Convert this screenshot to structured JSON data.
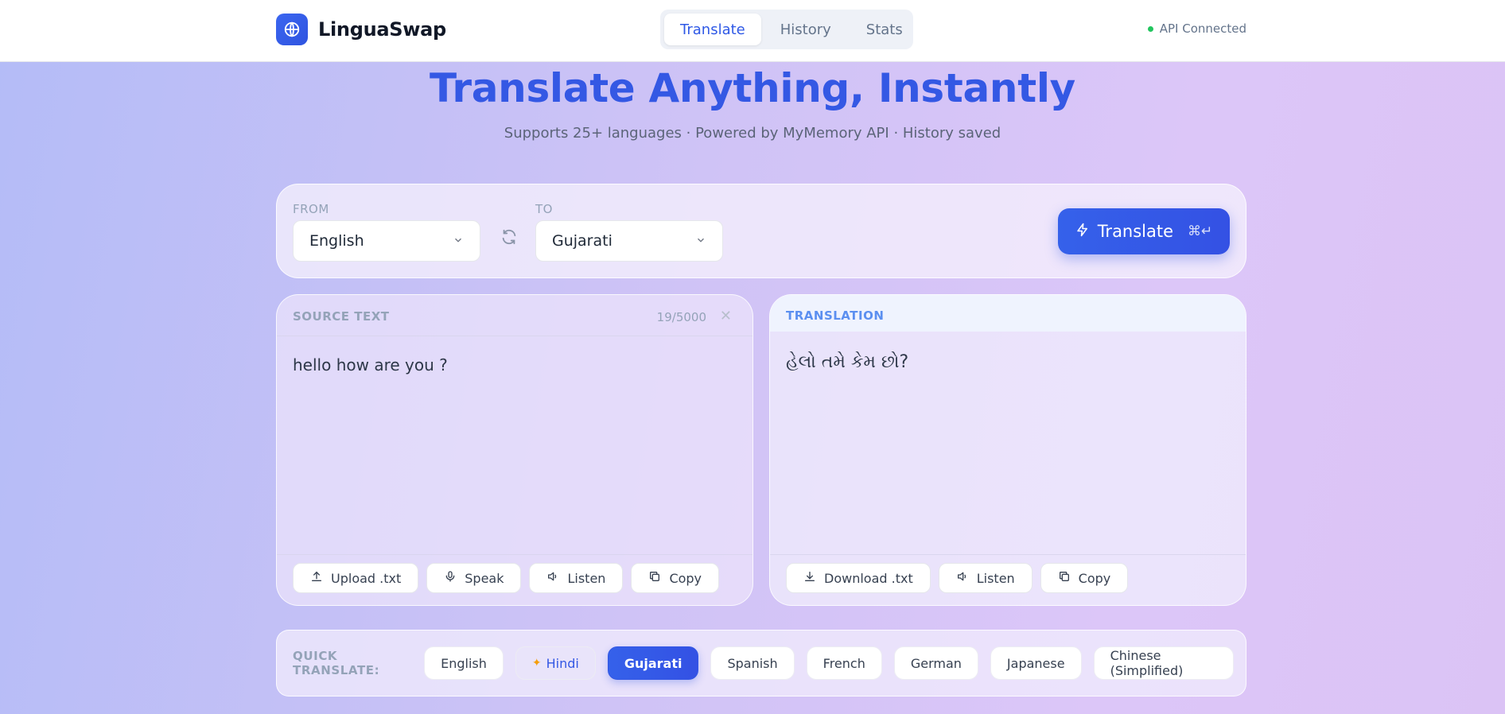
{
  "app": {
    "name": "LinguaSwap",
    "nav": [
      {
        "label": "Translate",
        "active": true
      },
      {
        "label": "History",
        "active": false
      },
      {
        "label": "Stats",
        "active": false
      }
    ],
    "api_status": "API Connected",
    "status_color": "#22c55e"
  },
  "hero": {
    "title": "Translate Anything, Instantly",
    "subtitle": "Supports 25+ languages · Powered by MyMemory API · History saved"
  },
  "languages": {
    "from_label": "FROM",
    "from_value": "English",
    "to_label": "TO",
    "to_value": "Gujarati",
    "translate_label": "Translate",
    "shortcut": "⌘↵"
  },
  "source": {
    "label": "SOURCE TEXT",
    "count": "19/5000",
    "text": "hello how are you ?",
    "actions": [
      "Upload .txt",
      "Speak",
      "Listen",
      "Copy"
    ]
  },
  "target": {
    "label": "TRANSLATION",
    "text": "હેલો તમે કેમ છો?",
    "actions": [
      "Download .txt",
      "Listen",
      "Copy"
    ]
  },
  "quick": {
    "label": "QUICK TRANSLATE:",
    "chips": [
      "English",
      "Hindi",
      "Gujarati",
      "Spanish",
      "French",
      "German",
      "Japanese",
      "Chinese (Simplified)"
    ],
    "active": "Gujarati",
    "hinted": "Hindi"
  },
  "colors": {
    "accent": "#3458e4",
    "muted_label": "#94a3b8",
    "translation_label": "#5b8ff0"
  }
}
